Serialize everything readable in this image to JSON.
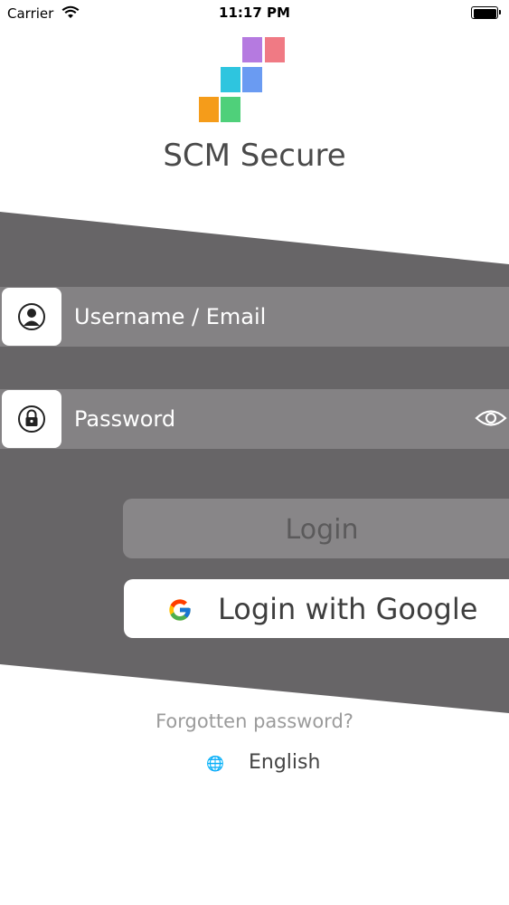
{
  "status_bar": {
    "carrier": "Carrier",
    "time": "11:17 PM"
  },
  "app": {
    "title": "SCM Secure"
  },
  "colors": {
    "band": "#676567",
    "field": "#848284",
    "logo_purple": "#b57ae0",
    "logo_pink": "#f07a84",
    "logo_cyan": "#2ec5df",
    "logo_blue": "#6a9bf2",
    "logo_orange": "#f59c1a",
    "logo_green": "#4fd07a"
  },
  "form": {
    "username_placeholder": "Username / Email",
    "password_placeholder": "Password",
    "login_label": "Login",
    "google_label": "Login with Google"
  },
  "footer": {
    "forgot_label": "Forgotten password?",
    "language_label": "English"
  },
  "icons": {
    "user": "user-icon",
    "lock": "lock-icon",
    "eye": "eye-icon",
    "google": "google-icon",
    "globe": "globe-icon"
  }
}
